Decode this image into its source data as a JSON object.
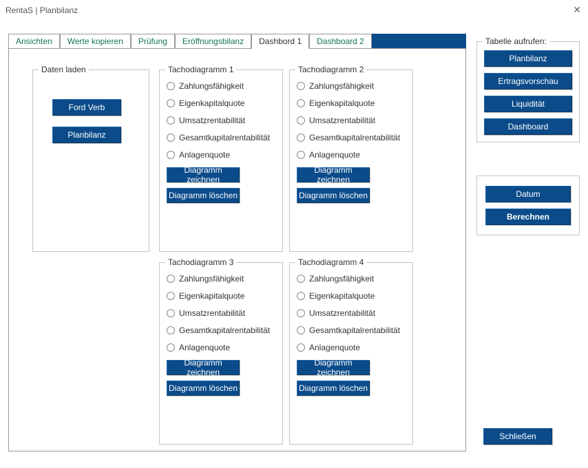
{
  "window": {
    "title": "RentaS | Planbilanz"
  },
  "tabs": {
    "items": [
      "Ansichten",
      "Werte kopieren",
      "Prüfung",
      "Eröffnungsbilanz",
      "Dashbord 1",
      "Dashboard 2"
    ],
    "active_index": 4
  },
  "daten_laden": {
    "title": "Daten laden",
    "ford_verb": "Ford  Verb",
    "planbilanz": "Planbilanz"
  },
  "tacho_options": [
    "Zahlungsfähigkeit",
    "Eigenkapitalquote",
    "Umsatzrentabilität",
    "Gesamtkapitalrentabilität",
    "Anlagenquote"
  ],
  "tacho_draw": "Diagramm zeichnen",
  "tacho_delete": "Diagramm löschen",
  "tacho_groups": {
    "t1": "Tachodiagramm 1",
    "t2": "Tachodiagramm 2",
    "t3": "Tachodiagramm 3",
    "t4": "Tachodiagramm 4"
  },
  "right": {
    "tabelle_aufrufen": "Tabelle aufrufen:",
    "planbilanz": "Planbilanz",
    "ertragsvorschau": "Ertragsvorschau",
    "liquiditaet": "Liquidität",
    "dashboard": "Dashboard",
    "datum": "Datum",
    "berechnen": "Berechnen"
  },
  "close": "Schließen"
}
